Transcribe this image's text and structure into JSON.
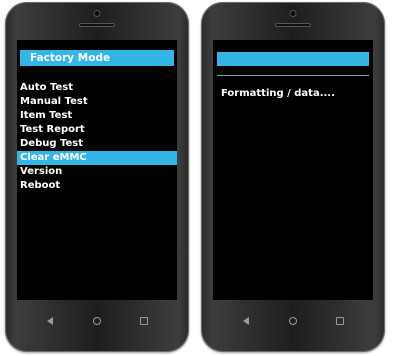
{
  "left_phone": {
    "title": "Factory Mode",
    "menu": [
      {
        "label": "Auto Test",
        "selected": false
      },
      {
        "label": "Manual Test",
        "selected": false
      },
      {
        "label": "Item Test",
        "selected": false
      },
      {
        "label": "Test Report",
        "selected": false
      },
      {
        "label": "Debug Test",
        "selected": false
      },
      {
        "label": "Clear eMMC",
        "selected": true
      },
      {
        "label": "Version",
        "selected": false
      },
      {
        "label": "Reboot",
        "selected": false
      }
    ]
  },
  "right_phone": {
    "status_text": "Formatting / data...."
  },
  "navbar": {
    "icons": [
      "back-icon",
      "home-icon",
      "recent-apps-icon"
    ]
  },
  "colors": {
    "accent": "#33b5e5",
    "screen_bg": "#000000",
    "text": "#ffffff"
  }
}
